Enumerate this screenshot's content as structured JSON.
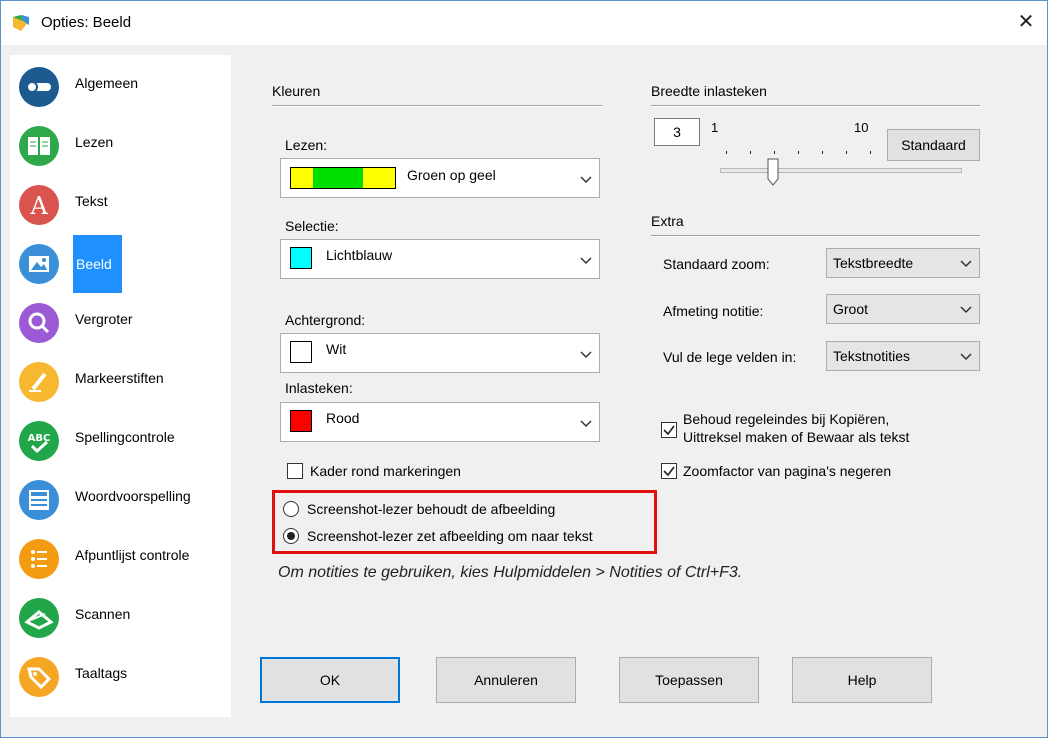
{
  "window": {
    "title": "Opties: Beeld",
    "close_glyph": "✕"
  },
  "sidebar": {
    "items": [
      {
        "label": "Algemeen",
        "icon": "toggle-icon",
        "color": "#1c5a8f"
      },
      {
        "label": "Lezen",
        "icon": "book-icon",
        "color": "#2ea84a"
      },
      {
        "label": "Tekst",
        "icon": "letter-a-icon",
        "color": "#d9534f"
      },
      {
        "label": "Beeld",
        "icon": "image-icon",
        "color": "#3a8fd8",
        "active": true
      },
      {
        "label": "Vergroter",
        "icon": "magnifier-icon",
        "color": "#9b59d6"
      },
      {
        "label": "Markeerstiften",
        "icon": "highlighter-icon",
        "color": "#f5b82e"
      },
      {
        "label": "Spellingcontrole",
        "icon": "abc-check-icon",
        "color": "#22a64a"
      },
      {
        "label": "Woordvoorspelling",
        "icon": "word-prediction-icon",
        "color": "#3a8fd8"
      },
      {
        "label": "Afpuntlijst controle",
        "icon": "checklist-icon",
        "color": "#f39c12"
      },
      {
        "label": "Scannen",
        "icon": "scanner-icon",
        "color": "#22a64a"
      },
      {
        "label": "Taaltags",
        "icon": "tag-icon",
        "color": "#f5a623"
      }
    ]
  },
  "colors_section": {
    "title": "Kleuren",
    "reading": {
      "label": "Lezen:",
      "value": "Groen op geel"
    },
    "selection": {
      "label": "Selectie:",
      "value": "Lichtblauw",
      "swatch": "#00ffff"
    },
    "background": {
      "label": "Achtergrond:",
      "value": "Wit",
      "swatch": "#ffffff"
    },
    "caret": {
      "label": "Inlasteken:",
      "value": "Rood",
      "swatch": "#ff0000"
    },
    "frame_checkbox": {
      "label": "Kader rond markeringen",
      "checked": false
    },
    "reading_colors": {
      "yellow": "#ffff00",
      "green": "#00e000"
    }
  },
  "screenshot_options": {
    "keep_image": {
      "label": "Screenshot-lezer behoudt de afbeelding",
      "selected": false
    },
    "convert_text": {
      "label": "Screenshot-lezer zet afbeelding om naar tekst",
      "selected": true
    }
  },
  "hint": "Om notities te gebruiken, kies Hulpmiddelen > Notities of Ctrl+F3.",
  "caret_width": {
    "title": "Breedte inlasteken",
    "value": "3",
    "min_label": "1",
    "max_label": "10",
    "slider_value": 3,
    "standard_button": "Standaard"
  },
  "extra": {
    "title": "Extra",
    "zoom": {
      "label": "Standaard zoom:",
      "value": "Tekstbreedte"
    },
    "note_size": {
      "label": "Afmeting notitie:",
      "value": "Groot"
    },
    "fill_fields": {
      "label": "Vul de lege velden in:",
      "value": "Tekstnotities"
    },
    "keep_linebreaks": {
      "label_line1": "Behoud regeleindes bij Kopiëren,",
      "label_line2": "Uittreksel maken of Bewaar als tekst",
      "checked": true
    },
    "ignore_zoom": {
      "label": "Zoomfactor van pagina's negeren",
      "checked": true
    }
  },
  "buttons": {
    "ok": "OK",
    "cancel": "Annuleren",
    "apply": "Toepassen",
    "help": "Help"
  }
}
